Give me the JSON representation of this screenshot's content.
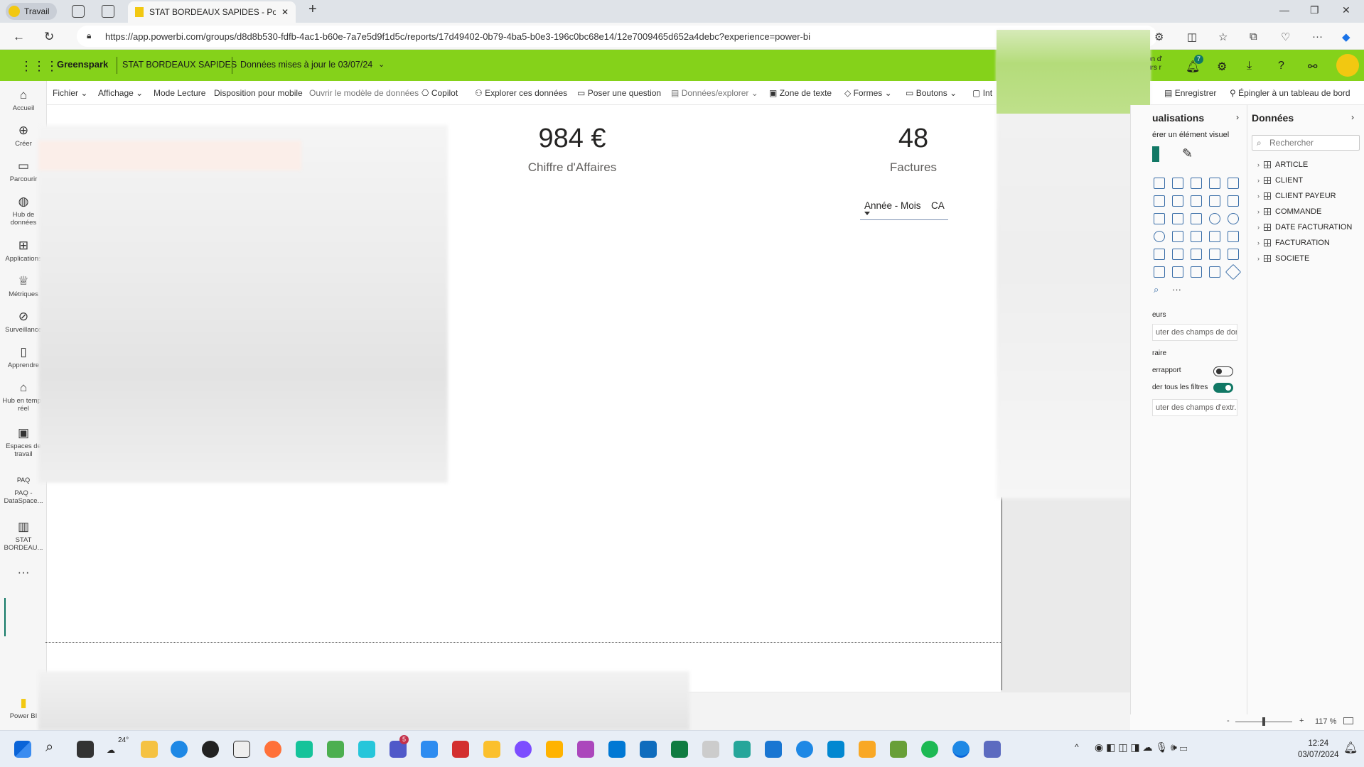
{
  "browser": {
    "profile_label": "Travail",
    "tab_title": "STAT BORDEAUX SAPIDES - Pow",
    "url": "https://app.powerbi.com/groups/d8d8b530-fdfb-4ac1-b60e-7a7e5d9f1d5c/reports/17d49402-0b79-4ba5-b0e3-196c0bc68e14/12e7009465d652a4debc?experience=power-bi",
    "new_tab": "+",
    "win_min": "—",
    "win_max": "❐",
    "win_close": "✕"
  },
  "header": {
    "workspace": "Greenspark",
    "report": "STAT BORDEAUX SAPIDES",
    "updated": "Données mises à jour le 03/07/24",
    "partial_1": "on d'",
    "partial_2": "urs r",
    "notif_count": "7"
  },
  "leftnav": {
    "items": [
      {
        "icon": "⌂",
        "label": "Accueil"
      },
      {
        "icon": "⊕",
        "label": "Créer"
      },
      {
        "icon": "▭",
        "label": "Parcourir"
      },
      {
        "icon": "◍",
        "label": "Hub de données"
      },
      {
        "icon": "⊞",
        "label": "Applications"
      },
      {
        "icon": "♕",
        "label": "Métriques"
      },
      {
        "icon": "⊘",
        "label": "Surveillance"
      },
      {
        "icon": "▯",
        "label": "Apprendre"
      },
      {
        "icon": "⌂",
        "label": "Hub en temps réel"
      },
      {
        "icon": "▣",
        "label": "Espaces de travail"
      },
      {
        "icon": "PAQ",
        "label": "PAQ - DataSpace..."
      },
      {
        "icon": "▥",
        "label": "STAT BORDEAU..."
      },
      {
        "icon": "···",
        "label": ""
      },
      {
        "icon": "▮",
        "label": "Power BI"
      }
    ]
  },
  "ribbon": {
    "fichier": "Fichier",
    "affichage": "Affichage",
    "mode_lecture": "Mode Lecture",
    "disposition": "Disposition pour mobile",
    "ouvrir_modele": "Ouvrir le modèle de données",
    "copilot": "Copilot",
    "explorer": "Explorer ces données",
    "poser": "Poser une question",
    "donnees_explorer": "Données/explorer",
    "zone_texte": "Zone de texte",
    "formes": "Formes",
    "boutons": "Boutons",
    "int": "Int",
    "enregistrer": "Enregistrer",
    "epingler": "Épingler à un tableau de bord"
  },
  "cards": {
    "ca_value": "984 €",
    "ca_label": "Chiffre d'Affaires",
    "factures_value": "48",
    "factures_label": "Factures"
  },
  "table": {
    "col1": "Année - Mois",
    "col2": "CA"
  },
  "viz_pane": {
    "title": "ualisations",
    "build": "érer un élément visuel",
    "values_label": "eurs",
    "values_well": "uter des champs de don...",
    "drill_label": "raire",
    "cross_report": "errapport",
    "keep_filters": "der tous les filtres",
    "drill_well": "uter des champs d'extr..."
  },
  "data_pane": {
    "title": "Données",
    "search_placeholder": "Rechercher",
    "tables": [
      "ARTICLE",
      "CLIENT",
      "CLIENT PAYEUR",
      "COMMANDE",
      "DATE FACTURATION",
      "FACTURATION",
      "SOCIETE"
    ]
  },
  "status": {
    "zoom": "117 %"
  },
  "taskbar": {
    "temp": "24°",
    "badge": "5",
    "time": "12:24",
    "date": "03/07/2024"
  }
}
